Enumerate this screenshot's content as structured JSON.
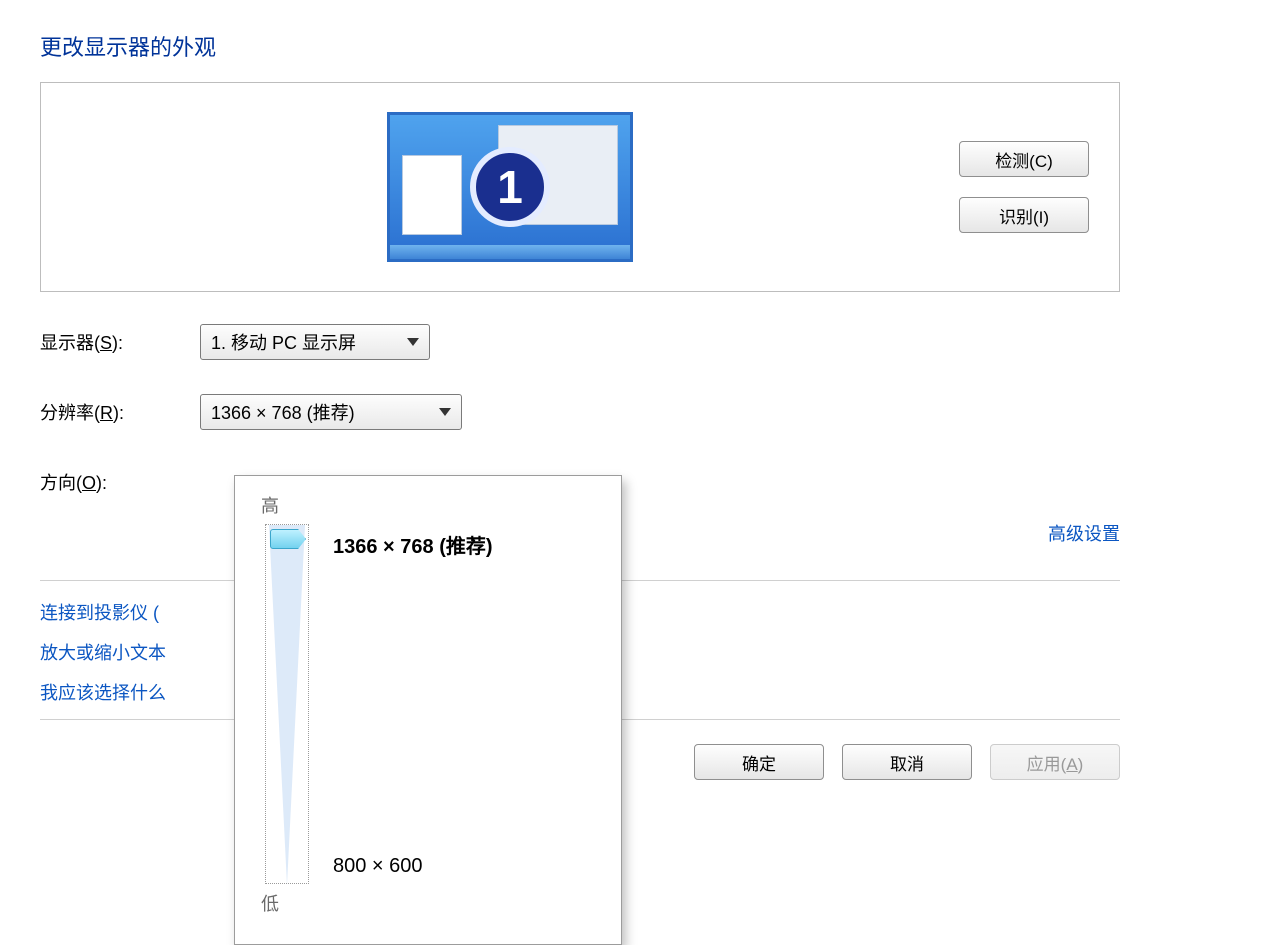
{
  "title": "更改显示器的外观",
  "monitor_badge": "1",
  "buttons": {
    "detect": "检测(C)",
    "identify": "识别(I)",
    "ok": "确定",
    "cancel": "取消",
    "apply": "应用(A)"
  },
  "labels": {
    "display": "显示器(S):",
    "resolution": "分辨率(R):",
    "orientation": "方向(O):"
  },
  "combos": {
    "display_value": "1. 移动 PC 显示屏",
    "resolution_value": "1366 × 768 (推荐)"
  },
  "slider": {
    "high": "高",
    "low": "低",
    "top_option": "1366 × 768 (推荐)",
    "bottom_option": "800 × 600"
  },
  "links": {
    "advanced": "高级设置",
    "projector": "连接到投影仪 (",
    "text_size": "放大或缩小文本",
    "which_settings": "我应该选择什么"
  }
}
